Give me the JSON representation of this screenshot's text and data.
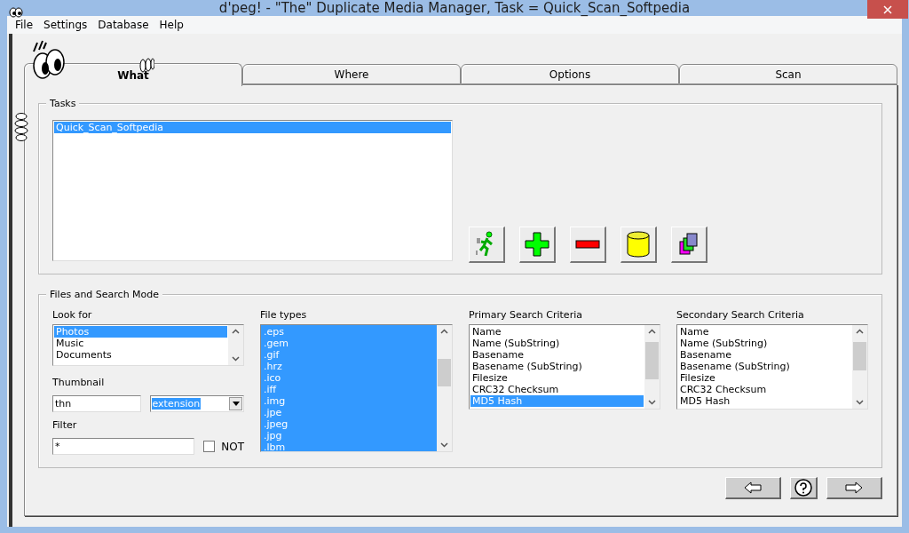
{
  "window": {
    "title": "d'peg! - \"The\" Duplicate Media Manager, Task = Quick_Scan_Softpedia"
  },
  "menu": [
    "File",
    "Settings",
    "Database",
    "Help"
  ],
  "tabs": [
    {
      "label": "What",
      "selected": true
    },
    {
      "label": "Where",
      "selected": false
    },
    {
      "label": "Options",
      "selected": false
    },
    {
      "label": "Scan",
      "selected": false
    }
  ],
  "tasks": {
    "label": "Tasks",
    "items": [
      {
        "label": "Quick_Scan_Softpedia",
        "selected": true
      }
    ]
  },
  "task_buttons": [
    {
      "kind": "run"
    },
    {
      "kind": "add"
    },
    {
      "kind": "remove"
    },
    {
      "kind": "database"
    },
    {
      "kind": "copy"
    }
  ],
  "files": {
    "label": "Files and Search Mode",
    "look_for": {
      "label": "Look for",
      "items": [
        {
          "label": "Photos",
          "selected": true
        },
        {
          "label": "Music",
          "selected": false
        },
        {
          "label": "Documents",
          "selected": false
        }
      ]
    },
    "thumbnail": {
      "label": "Thumbnail",
      "value": "thn",
      "mode": "extension"
    },
    "filter": {
      "label": "Filter",
      "value": "*",
      "not_label": "NOT",
      "not_checked": false
    },
    "file_types": {
      "label": "File types",
      "items": [
        {
          "label": ".eps",
          "selected": true
        },
        {
          "label": ".gem",
          "selected": true
        },
        {
          "label": ".gif",
          "selected": true
        },
        {
          "label": ".hrz",
          "selected": true
        },
        {
          "label": ".ico",
          "selected": true
        },
        {
          "label": ".iff",
          "selected": true
        },
        {
          "label": ".img",
          "selected": true
        },
        {
          "label": ".jpe",
          "selected": true
        },
        {
          "label": ".jpeg",
          "selected": true
        },
        {
          "label": ".jpg",
          "selected": true
        },
        {
          "label": ".lbm",
          "selected": true
        }
      ]
    },
    "primary": {
      "label": "Primary Search Criteria",
      "items": [
        {
          "label": "Name",
          "selected": false
        },
        {
          "label": "Name (SubString)",
          "selected": false
        },
        {
          "label": "Basename",
          "selected": false
        },
        {
          "label": "Basename (SubString)",
          "selected": false
        },
        {
          "label": "Filesize",
          "selected": false
        },
        {
          "label": "CRC32 Checksum",
          "selected": false
        },
        {
          "label": "MD5 Hash",
          "selected": true
        }
      ]
    },
    "secondary": {
      "label": "Secondary Search Criteria",
      "items": [
        {
          "label": "Name",
          "selected": false
        },
        {
          "label": "Name (SubString)",
          "selected": false
        },
        {
          "label": "Basename",
          "selected": false
        },
        {
          "label": "Basename (SubString)",
          "selected": false
        },
        {
          "label": "Filesize",
          "selected": false
        },
        {
          "label": "CRC32 Checksum",
          "selected": false
        },
        {
          "label": "MD5 Hash",
          "selected": false
        }
      ]
    }
  },
  "nav_buttons": [
    {
      "kind": "back"
    },
    {
      "kind": "help"
    },
    {
      "kind": "next"
    }
  ]
}
